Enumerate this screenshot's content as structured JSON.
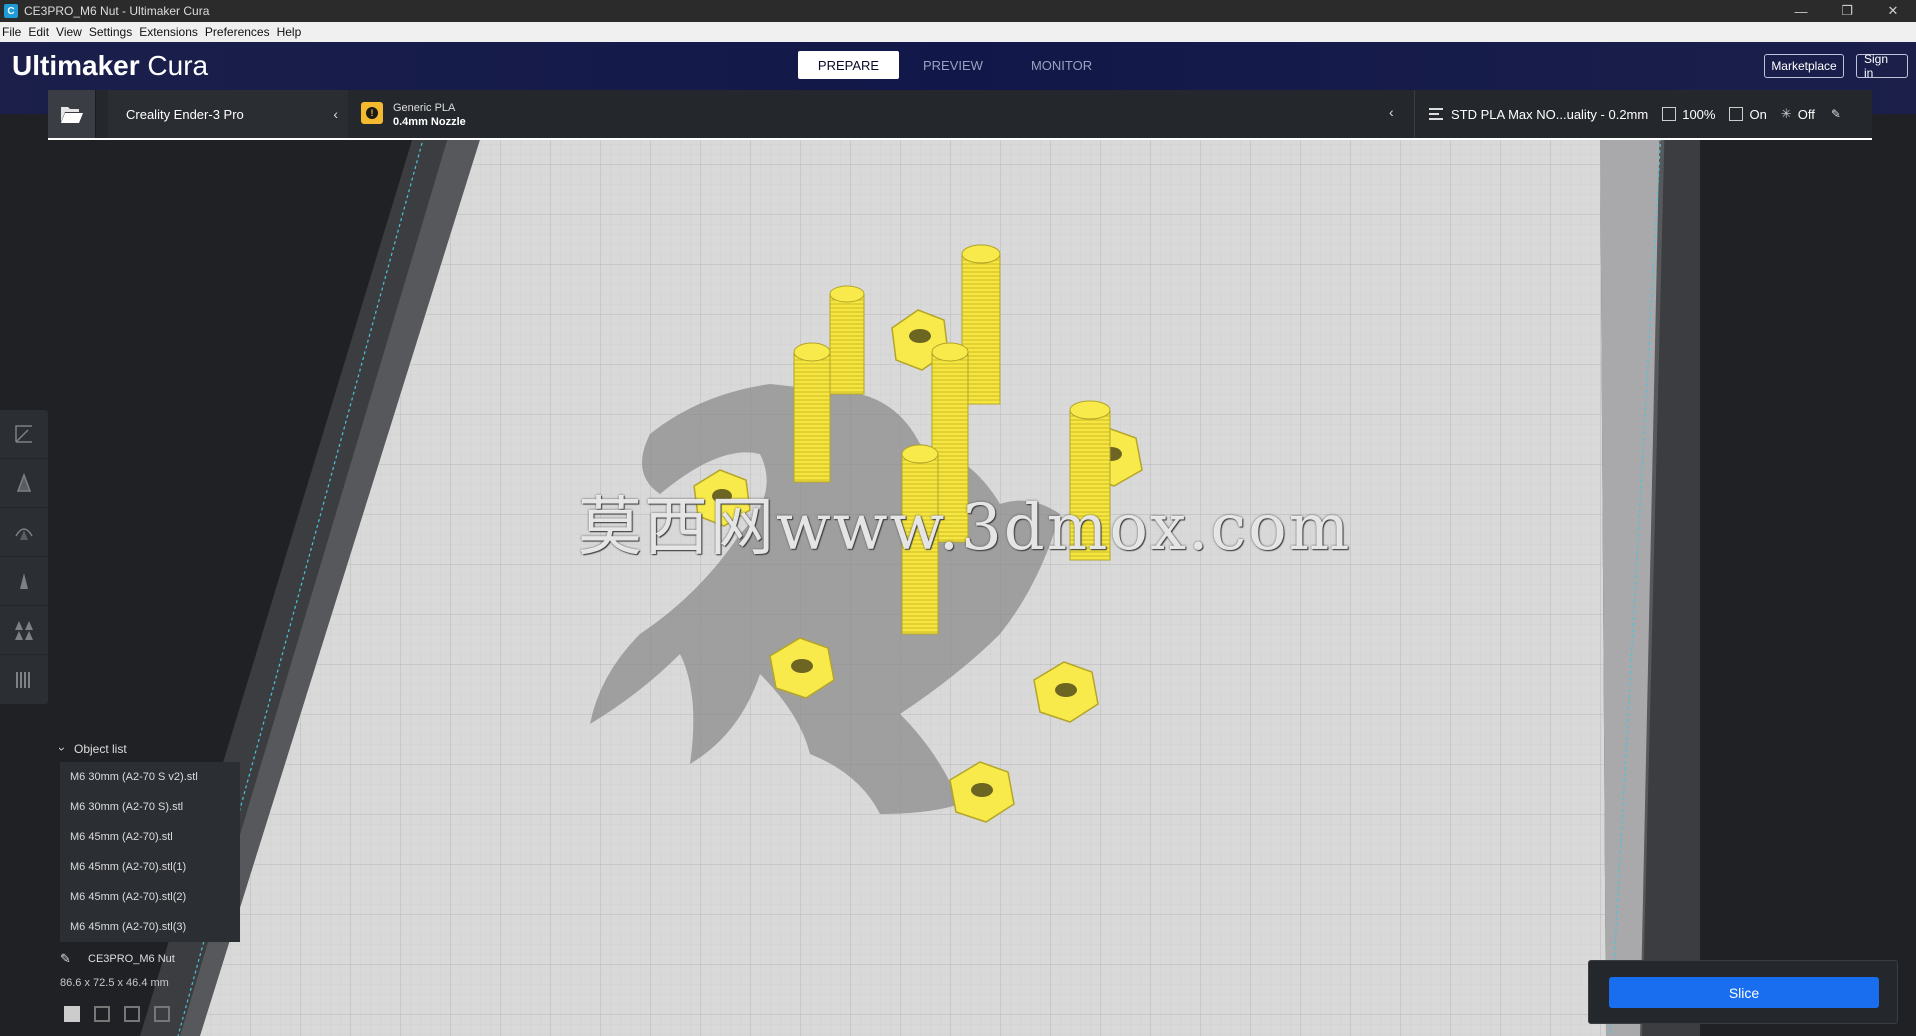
{
  "window": {
    "title": "CE3PRO_M6 Nut - Ultimaker Cura",
    "app_icon": "C",
    "minimize_icon": "—",
    "restore_icon": "❐",
    "close_icon": "✕"
  },
  "menu": [
    "File",
    "Edit",
    "View",
    "Settings",
    "Extensions",
    "Preferences",
    "Help"
  ],
  "header": {
    "brand_bold": "Ultimaker",
    "brand_light": "Cura",
    "tabs": [
      "PREPARE",
      "PREVIEW",
      "MONITOR"
    ],
    "active_tab": "PREPARE",
    "marketplace_label": "Marketplace",
    "signin_label": "Sign in"
  },
  "printer": {
    "machine": "Creality Ender-3 Pro",
    "material": "Generic PLA",
    "nozzle": "0.4mm Nozzle",
    "material_badge": "!",
    "profile": "STD PLA Max NO...uality - 0.2mm",
    "infill": "100%",
    "support": "On",
    "adhesion": "Off"
  },
  "toolbar": [
    "move-tool",
    "scale-tool",
    "rotate-tool",
    "mirror-tool",
    "per-model-settings-tool",
    "support-blocker-tool"
  ],
  "object_list": {
    "header": "Object list",
    "items": [
      "M6 30mm (A2-70 S v2).stl",
      "M6 30mm (A2-70 S).stl",
      "M6 45mm (A2-70).stl",
      "M6 45mm (A2-70).stl(1)",
      "M6 45mm (A2-70).stl(2)",
      "M6 45mm (A2-70).stl(3)"
    ],
    "job_name": "CE3PRO_M6 Nut",
    "dimensions": "86.6 x 72.5 x 46.4 mm"
  },
  "slice": {
    "label": "Slice"
  },
  "watermark": "莫西网www.3dmox.com",
  "colors": {
    "accent": "#196ef0",
    "model_yellow": "#f7ea4a",
    "header_bg": "#141a3a"
  }
}
